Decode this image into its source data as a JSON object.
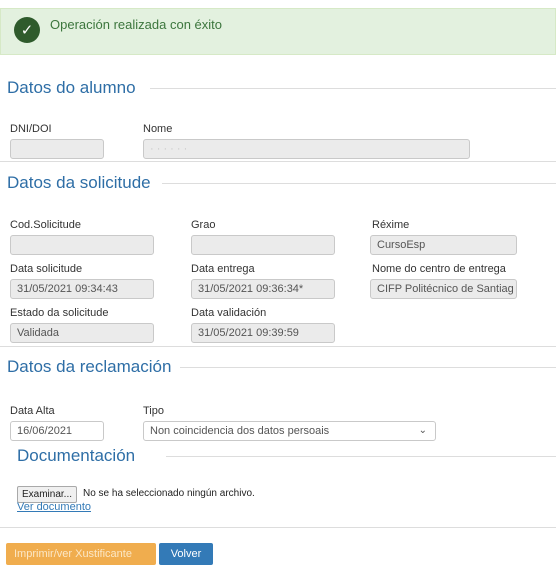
{
  "alert": {
    "message": "Operación realizada con éxito"
  },
  "alumno": {
    "title": "Datos do alumno",
    "dni_label": "DNI/DOI",
    "dni_value": "",
    "nome_label": "Nome",
    "nome_value": "· · · · · ·"
  },
  "solicitude": {
    "title": "Datos da solicitude",
    "cod_label": "Cod.Solicitude",
    "cod_value": "",
    "grao_label": "Grao",
    "grao_value": "",
    "rexime_label": "Réxime",
    "rexime_value": "CursoEsp",
    "data_solicitude_label": "Data solicitude",
    "data_solicitude_value": "31/05/2021 09:34:43",
    "data_entrega_label": "Data entrega",
    "data_entrega_value": "31/05/2021 09:36:34*",
    "centro_label": "Nome do centro de entrega",
    "centro_value": "CIFP Politécnico de Santiag",
    "estado_label": "Estado da solicitude",
    "estado_value": "Validada",
    "data_validacion_label": "Data validación",
    "data_validacion_value": "31/05/2021 09:39:59"
  },
  "reclamacion": {
    "title": "Datos da reclamación",
    "data_alta_label": "Data Alta",
    "data_alta_value": "16/06/2021",
    "tipo_label": "Tipo",
    "tipo_value": "Non coincidencia dos datos persoais"
  },
  "documentacion": {
    "title": "Documentación",
    "browse_label": "Examinar...",
    "no_file_text": "No se ha seleccionado ningún archivo.",
    "view_link": "Ver documento"
  },
  "actions": {
    "print_label": "Imprimir/ver Xustificante",
    "back_label": "Volver"
  },
  "colors": {
    "accent": "#2e6ea6",
    "success_bg": "#e3f1df",
    "success_icon": "#2f5b2c",
    "warning": "#f0ad4e",
    "primary": "#337ab7"
  }
}
